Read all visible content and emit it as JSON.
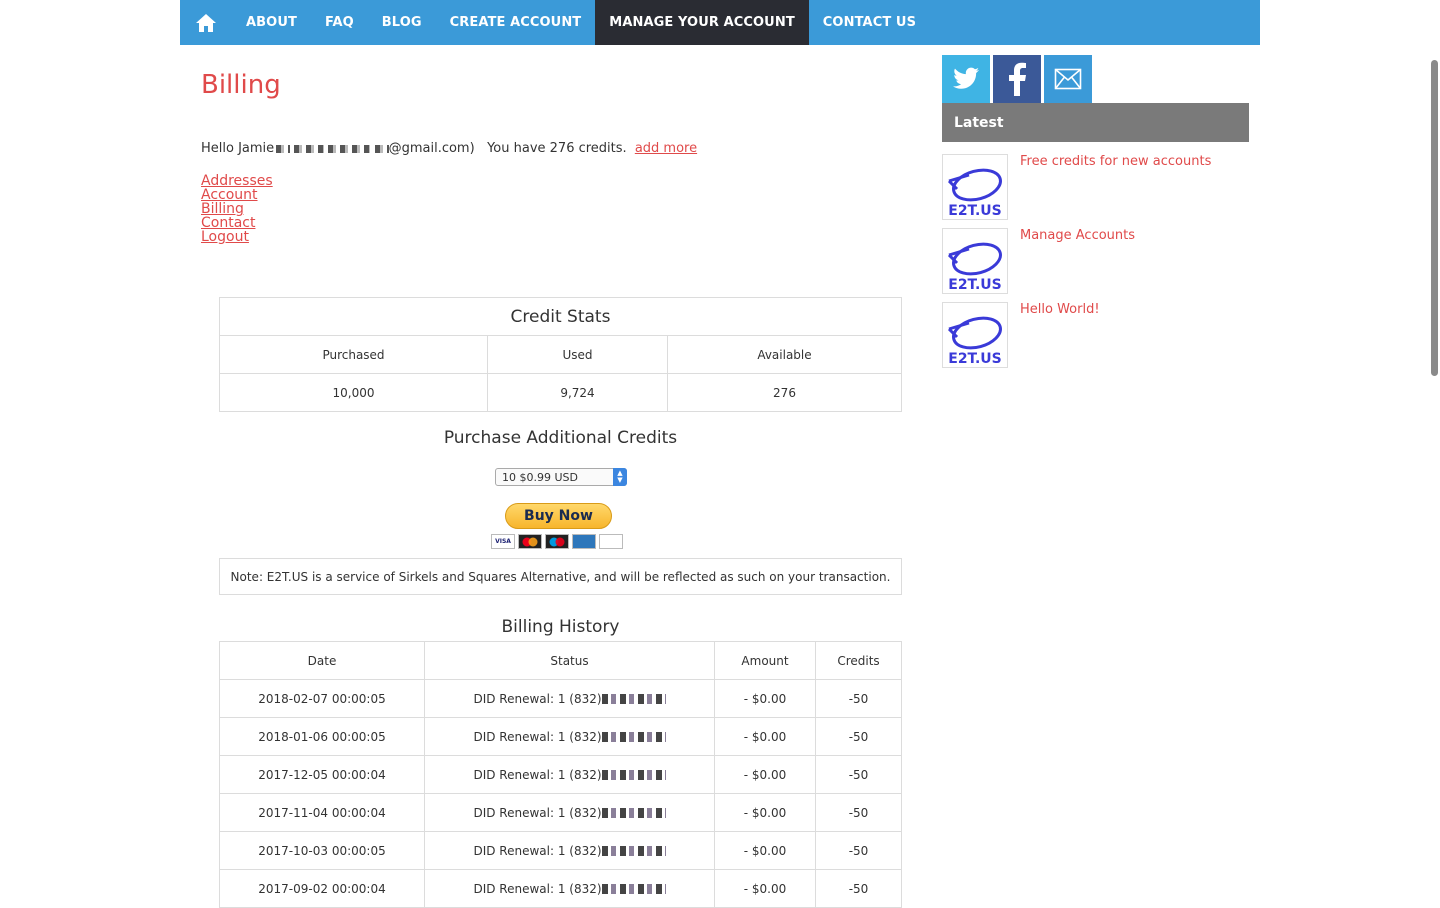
{
  "nav": {
    "items": [
      "ABOUT",
      "FAQ",
      "BLOG",
      "CREATE ACCOUNT",
      "MANAGE YOUR ACCOUNT",
      "CONTACT US"
    ],
    "active": "MANAGE YOUR ACCOUNT",
    "home_icon": "home-icon"
  },
  "page": {
    "title": "Billing",
    "hello_prefix": "Hello Jamie",
    "hello_email_suffix": "@gmail.com)",
    "credits_text": "You have 276 credits.",
    "add_more": "add more"
  },
  "account_links": [
    "Addresses",
    "Account",
    "Billing",
    "Contact",
    "Logout"
  ],
  "credit_stats": {
    "title": "Credit Stats",
    "headers": [
      "Purchased",
      "Used",
      "Available"
    ],
    "values": [
      "10,000",
      "9,724",
      "276"
    ]
  },
  "purchase": {
    "title": "Purchase Additional Credits",
    "selected_option": "10 $0.99 USD",
    "buy_label": "Buy Now",
    "cards": [
      "VISA",
      "MC",
      "MAESTRO",
      "AMEX",
      "DISCOVER"
    ]
  },
  "note": "Note: E2T.US is a service of Sirkels and Squares Alternative, and will be reflected as such on your transaction.",
  "billing_history": {
    "title": "Billing History",
    "headers": [
      "Date",
      "Status",
      "Amount",
      "Credits"
    ],
    "rows": [
      {
        "date": "2018-02-07 00:00:05",
        "status": "DID Renewal: 1 (832)",
        "amount": "- $0.00",
        "credits": "-50"
      },
      {
        "date": "2018-01-06 00:00:05",
        "status": "DID Renewal: 1 (832)",
        "amount": "- $0.00",
        "credits": "-50"
      },
      {
        "date": "2017-12-05 00:00:04",
        "status": "DID Renewal: 1 (832)",
        "amount": "- $0.00",
        "credits": "-50"
      },
      {
        "date": "2017-11-04 00:00:04",
        "status": "DID Renewal: 1 (832)",
        "amount": "- $0.00",
        "credits": "-50"
      },
      {
        "date": "2017-10-03 00:00:05",
        "status": "DID Renewal: 1 (832)",
        "amount": "- $0.00",
        "credits": "-50"
      },
      {
        "date": "2017-09-02 00:00:04",
        "status": "DID Renewal: 1 (832)",
        "amount": "- $0.00",
        "credits": "-50"
      }
    ]
  },
  "sidebar": {
    "social": [
      "twitter-icon",
      "facebook-icon",
      "mail-icon"
    ],
    "latest_title": "Latest",
    "posts": [
      "Free credits for new accounts",
      "Manage Accounts",
      "Hello World!"
    ],
    "thumb_logo": "E2T.US"
  },
  "colors": {
    "nav_bg": "#3b9ad8",
    "nav_active": "#2a2c33",
    "accent_red": "#e04a4a",
    "latest_bg": "#7a7a7a"
  }
}
